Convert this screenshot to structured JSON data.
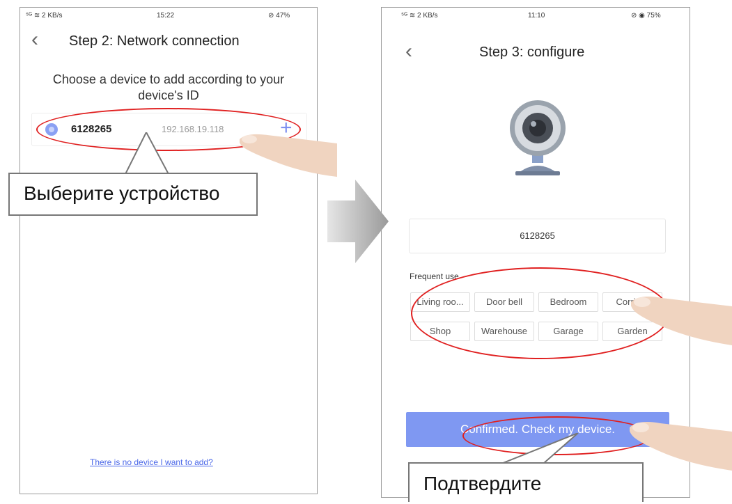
{
  "left_screen": {
    "status": {
      "signal": "⁵ᴳ ≋ 2 KB/s",
      "time": "15:22",
      "battery": "⊘ 47%"
    },
    "back_icon": "chevron-left-icon",
    "title": "Step 2: Network connection",
    "subtitle_line1": "Choose a device to add according to your",
    "subtitle_line2": "device's ID",
    "device": {
      "id": "6128265",
      "ip": "192.168.19.118",
      "add_icon": "plus-icon"
    },
    "no_device_link": "There is no device I want to add?"
  },
  "right_screen": {
    "status": {
      "signal": "⁵ᴳ ≋ 2 KB/s",
      "time": "11:10",
      "battery": "⊘ ◉ 75%"
    },
    "back_icon": "chevron-left-icon",
    "title": "Step 3: configure",
    "device_id": "6128265",
    "frequent_use_label": "Frequent use",
    "tags": [
      "Living roo...",
      "Door bell",
      "Bedroom",
      "Corridor",
      "Shop",
      "Warehouse",
      "Garage",
      "Garden"
    ],
    "confirm_button": "Confirmed. Check my device."
  },
  "callouts": {
    "select_device": "Выберите устройство",
    "confirm": "Подтвердите"
  },
  "colors": {
    "accent": "#7f98f2",
    "highlight": "#e02020",
    "link": "#4a67e8"
  }
}
